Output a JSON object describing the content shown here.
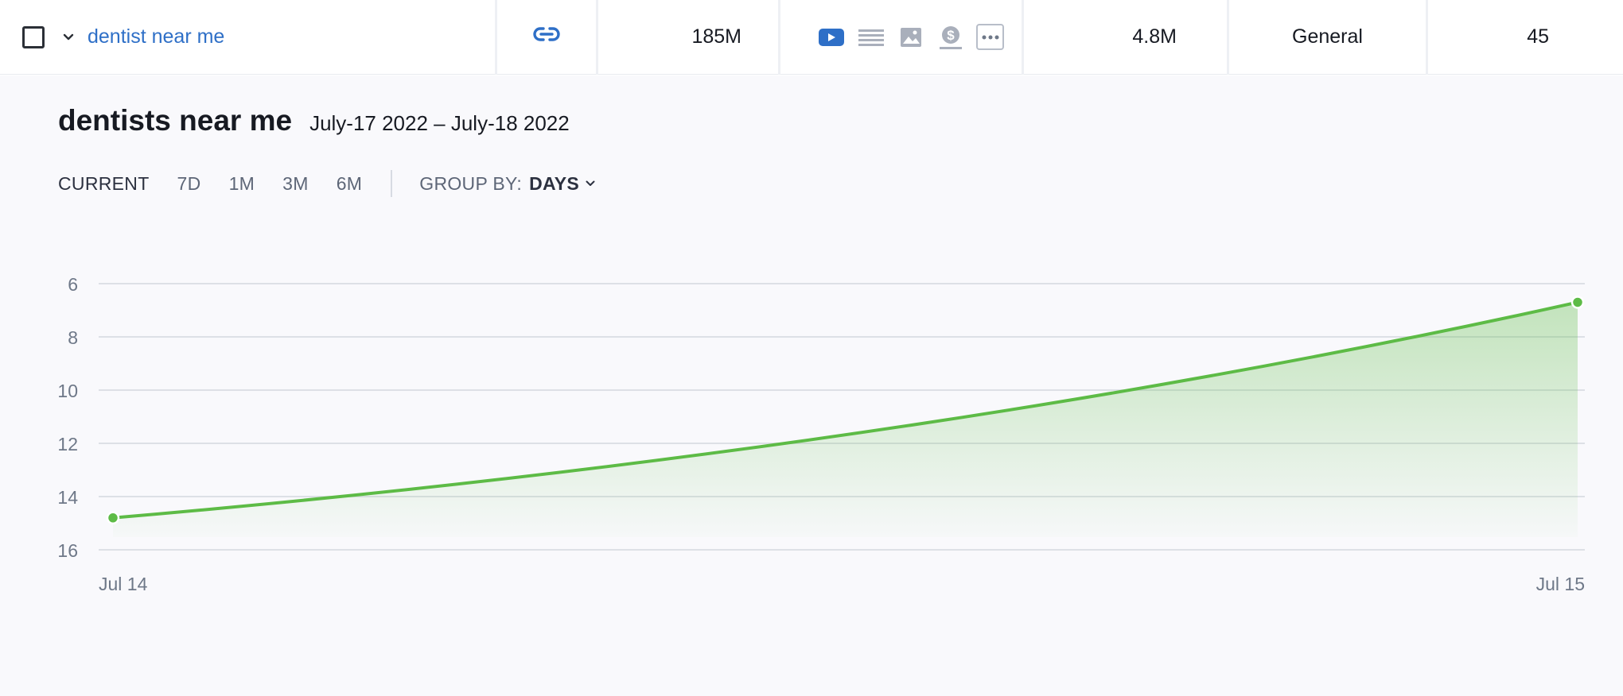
{
  "row": {
    "keyword": "dentist near me",
    "volume": "185M",
    "results": "4.8M",
    "category": "General",
    "kd": "45",
    "intent_icon": "link-icon",
    "features": [
      "video-icon",
      "list-icon",
      "image-icon",
      "dollar-icon",
      "more-icon"
    ]
  },
  "panel": {
    "keyword": "dentists near me",
    "date_range": "July-17 2022 – July-18 2022",
    "periods": [
      "CURRENT",
      "7D",
      "1M",
      "3M",
      "6M"
    ],
    "active_period": "CURRENT",
    "group_by_label": "GROUP BY:",
    "group_by_value": "DAYS"
  },
  "colors": {
    "link": "#2e6fc7",
    "line": "#5dbb46",
    "grid": "#dde0e6",
    "axis_text": "#6e7888"
  },
  "chart_data": {
    "type": "area",
    "x": [
      "Jul 14",
      "Jul 15"
    ],
    "series": [
      {
        "values": [
          14.8,
          6.7
        ]
      }
    ],
    "y_ticks": [
      6,
      8,
      10,
      12,
      14,
      16
    ],
    "ylim": [
      6,
      16
    ],
    "y_inverted": true,
    "grid": true
  }
}
